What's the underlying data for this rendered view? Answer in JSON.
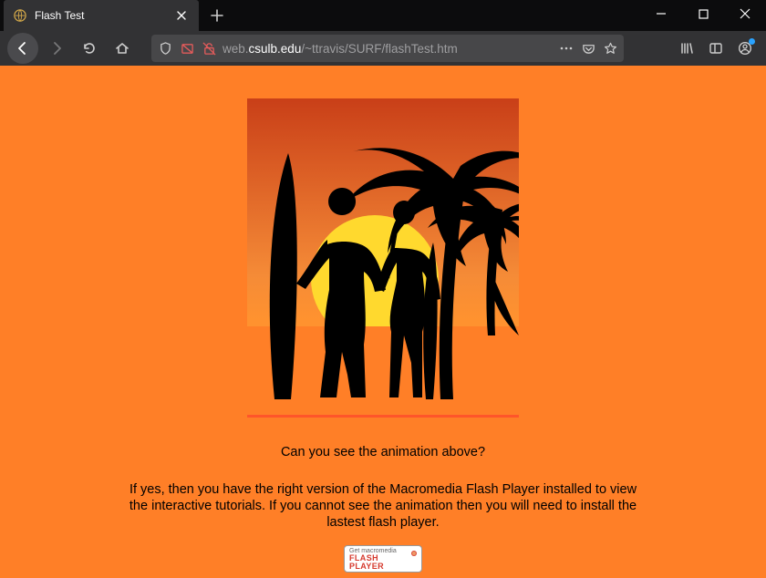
{
  "browser": {
    "tab": {
      "title": "Flash Test",
      "favicon": "globe-icon"
    },
    "url_prefix": "web.",
    "url_domain": "csulb.edu",
    "url_path": "/~ttravis/SURF/flashTest.htm"
  },
  "page": {
    "question": "Can you see the animation above?",
    "instructions": "If yes, then you have the right version of the Macromedia Flash Player installed to view the interactive tutorials. If you cannot see the animation then you will need to install the lastest flash player.",
    "badge": {
      "line1": "Get macromedia",
      "line2": "FLASH",
      "line3": "PLAYER"
    }
  }
}
